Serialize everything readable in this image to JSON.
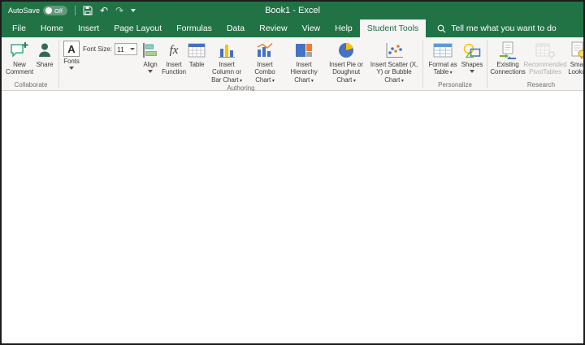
{
  "colors": {
    "excel_green": "#217346",
    "active_tab_text": "#1e6b43",
    "ribbon_bg": "#f6f5f4"
  },
  "titlebar": {
    "autosave_label": "AutoSave",
    "autosave_state": "Off",
    "title": "Book1 - Excel"
  },
  "icons": {
    "undo_glyph": "↶",
    "redo_glyph": "↷",
    "fonts_glyph": "A",
    "function_glyph": "fx"
  },
  "tabs": {
    "items": [
      {
        "label": "File"
      },
      {
        "label": "Home"
      },
      {
        "label": "Insert"
      },
      {
        "label": "Page Layout"
      },
      {
        "label": "Formulas"
      },
      {
        "label": "Data"
      },
      {
        "label": "Review"
      },
      {
        "label": "View"
      },
      {
        "label": "Help"
      },
      {
        "label": "Student Tools",
        "active": true
      }
    ],
    "search_label": "Tell me what you want to do"
  },
  "ribbon": {
    "groups": [
      {
        "name": "Collaborate",
        "buttons": [
          {
            "label": "New Comment"
          },
          {
            "label": "Share"
          }
        ]
      },
      {
        "name": "Authoring",
        "fonts": {
          "label": "Fonts",
          "size_label": "Font Size:",
          "size_value": "11"
        },
        "buttons": [
          {
            "label": "Align"
          },
          {
            "label": "Insert Function"
          },
          {
            "label": "Table"
          },
          {
            "label": "Insert Column or Bar Chart"
          },
          {
            "label": "Insert Combo Chart"
          },
          {
            "label": "Insert Hierarchy Chart"
          },
          {
            "label": "Insert Pie or Doughnut Chart"
          },
          {
            "label": "Insert Scatter (X, Y) or Bubble Chart"
          }
        ]
      },
      {
        "name": "Personalize",
        "buttons": [
          {
            "label": "Format as Table"
          },
          {
            "label": "Shapes"
          }
        ]
      },
      {
        "name": "Research",
        "buttons": [
          {
            "label": "Existing Connections"
          },
          {
            "label": "Recommended PivotTables",
            "disabled": true
          },
          {
            "label": "Smart Lookup"
          }
        ]
      }
    ]
  }
}
